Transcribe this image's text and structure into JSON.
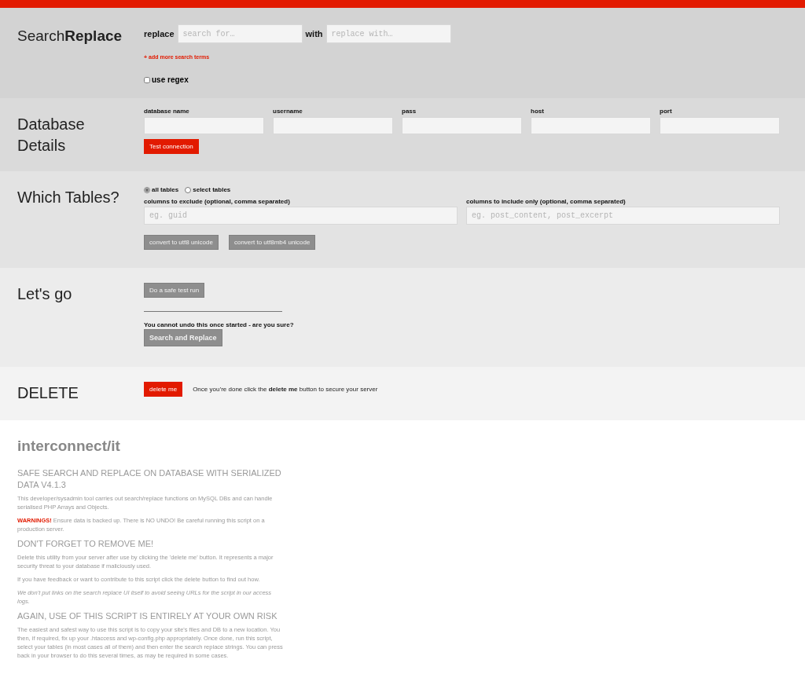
{
  "header": {
    "title": "Search**Replace**",
    "replace_label": "replace",
    "search_placeholder": "search for…",
    "with_label": "with",
    "replace_placeholder": "replace with…",
    "add_more": "+ add more search terms",
    "use_regex": {
      "label": "use regex",
      "checked": false
    }
  },
  "database": {
    "title": "Database Details",
    "fields": [
      {
        "label": "database name"
      },
      {
        "label": "username"
      },
      {
        "label": "pass"
      },
      {
        "label": "host"
      },
      {
        "label": "port"
      }
    ],
    "test_button": "Test connection"
  },
  "tables": {
    "title": "Which Tables?",
    "options": [
      {
        "label": "all tables",
        "selected": true
      },
      {
        "label": "select tables",
        "selected": false
      }
    ],
    "exclude": {
      "label": "columns to exclude (optional, comma separated)",
      "placeholder": "eg. guid"
    },
    "include": {
      "label": "columns to include only (optional, comma separated)",
      "placeholder": "eg. post_content, post_excerpt"
    },
    "buttons": [
      {
        "label": "convert to utf8 unicode",
        "disabled": true
      },
      {
        "label": "convert to utf8mb4 unicode",
        "disabled": true
      }
    ]
  },
  "go": {
    "title": "Let's go",
    "test_run": {
      "label": "Do a safe test run",
      "disabled": true
    },
    "warning": "You cannot undo this once started - are you sure?",
    "run": {
      "label": "Search and Replace",
      "disabled": true
    }
  },
  "delete": {
    "title": "DELETE",
    "button": "delete me",
    "note": "Once you’re done click the **delete me** button to secure your server"
  },
  "footer": {
    "brand": "interconnect/it",
    "blocks": [
      {
        "kind": "heading",
        "text": "SAFE SEARCH AND REPLACE ON DATABASE WITH SERIALIZED DATA V4.1.3"
      },
      {
        "kind": "paragraph",
        "text": "This developer/sysadmin tool carries out search/replace functions on MySQL DBs and can handle serialised PHP Arrays and Objects."
      },
      {
        "kind": "warning",
        "label": "WARNINGS!",
        "text": "Ensure data is backed up. There is NO UNDO! Be careful running this script on a production server."
      },
      {
        "kind": "heading",
        "text": "DON'T FORGET TO REMOVE ME!"
      },
      {
        "kind": "paragraph",
        "text": "Delete this utility from your server after use by clicking the 'delete me' button. It represents a major security threat to your database if maliciously used."
      },
      {
        "kind": "paragraph",
        "text": "If you have feedback or want to contribute to this script click the delete button to find out how."
      },
      {
        "kind": "note",
        "text": "We don't put links on the search replace UI itself to avoid seeing URLs for the script in our access logs."
      },
      {
        "kind": "heading",
        "text": "AGAIN, USE OF THIS SCRIPT IS ENTIRELY AT YOUR OWN RISK"
      },
      {
        "kind": "paragraph",
        "text": "The easiest and safest way to use this script is to copy your site's files and DB to a new location. You then, if required, fix up your .htaccess and wp-config.php appropriately. Once done, run this script, select your tables (in most cases all of them) and then enter the search replace strings. You can press back in your browser to do this several times, as may be required in some cases."
      }
    ]
  }
}
